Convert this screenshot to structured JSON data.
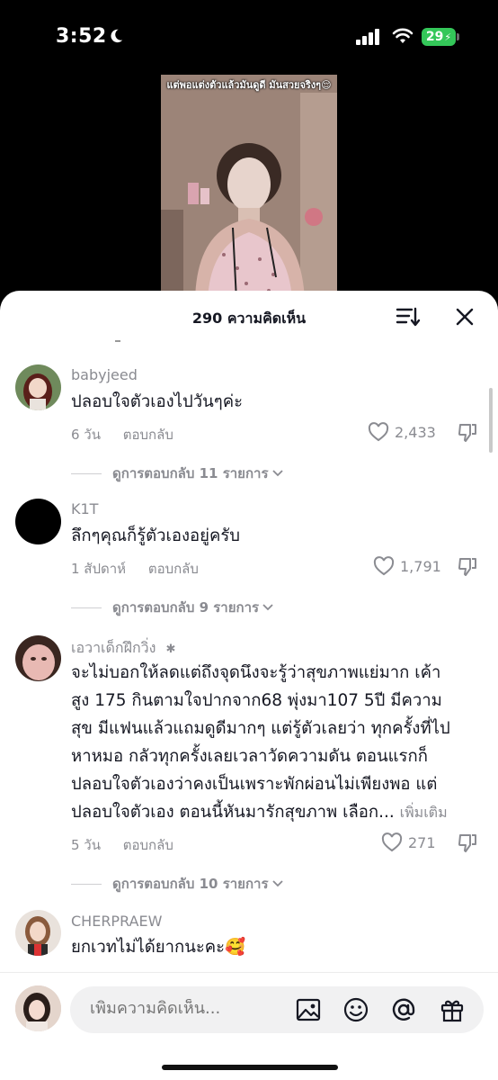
{
  "status": {
    "time": "3:52",
    "battery": "29"
  },
  "video": {
    "caption": "แต่พอแต่งตัวแล้วมันดูดี มันสวยจริงๆ😌"
  },
  "header": {
    "title": "290 ความคิดเห็น"
  },
  "comments": [
    {
      "username": "babyjeed",
      "text": "ปลอบใจตัวเองไปวันๆค่ะ",
      "time": "6 วัน",
      "reply_label": "ตอบกลับ",
      "likes": "2,433",
      "view_replies": "ดูการตอบกลับ 11 รายการ"
    },
    {
      "username": "K1T",
      "text": "ลึกๆคุณก็รู้ตัวเองอยู่ครับ",
      "time": "1 สัปดาห์",
      "reply_label": "ตอบกลับ",
      "likes": "1,791",
      "view_replies": "ดูการตอบกลับ 9 รายการ"
    },
    {
      "username": "เอวาเด็กฝึกวิ่ง",
      "text_lines": [
        "จะไม่บอกให้ลดแต่ถึงจุดนึงจะรู้ว่าสุขภาพแย่มาก เค้า",
        "สูง 175 กินตามใจปากจาก68 พุ่งมา107 5ปี มีความ",
        "สุข มีแฟนแล้วแถมดูดีมากๆ แต่รู้ตัวเลยว่า ทุกครั้งที่ไป",
        "หาหมอ กลัวทุกครั้งเลยเวลาวัดความดัน ตอนแรกก็",
        "ปลอบใจตัวเองว่าคงเป็นเพราะพักผ่อนไม่เพียงพอ แต่",
        "ปลอบใจตัวเอง ตอนนี้หันมารักสุขภาพ เลือก..."
      ],
      "more_label": "เพิ่มเติม",
      "time": "5 วัน",
      "reply_label": "ตอบกลับ",
      "likes": "271",
      "view_replies": "ดูการตอบกลับ 10 รายการ"
    },
    {
      "username": "CHERPRAEW",
      "text": "ยกเวทไม่ได้ยากนะคะ🥰"
    }
  ],
  "input": {
    "placeholder": "เพิ่มความคิดเห็น..."
  },
  "colors": {
    "accent_battery": "#34c759",
    "text_primary": "#161823",
    "text_secondary": "#8a8b91"
  }
}
